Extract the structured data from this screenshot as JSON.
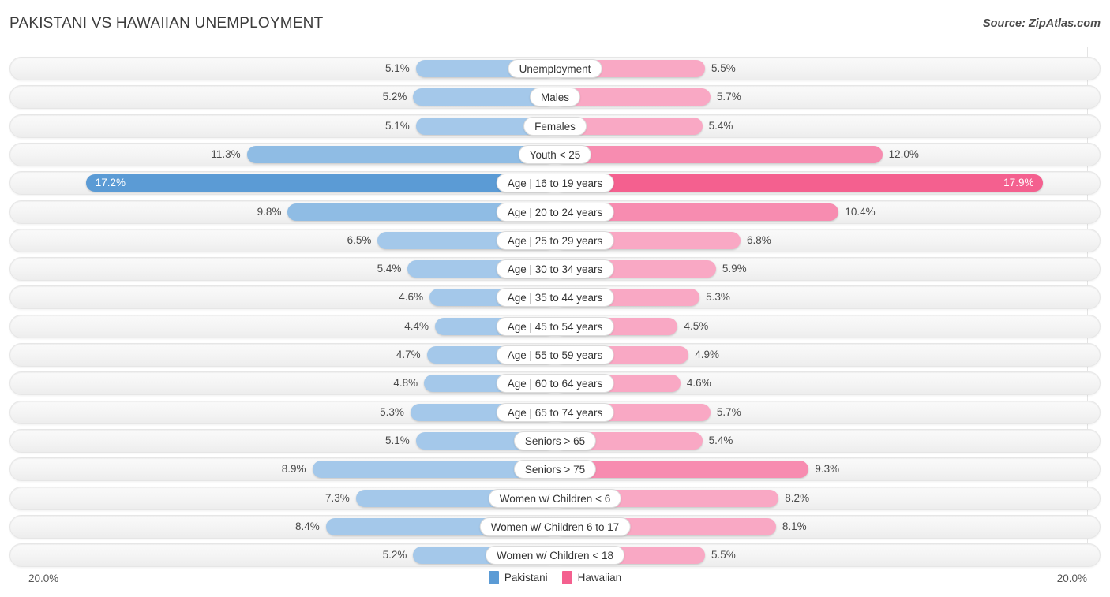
{
  "header": {
    "title": "PAKISTANI VS HAWAIIAN UNEMPLOYMENT",
    "source": "Source: ZipAtlas.com"
  },
  "legend": {
    "items": [
      {
        "label": "Pakistani",
        "color": "#5b9bd5",
        "icon": "square-swatch"
      },
      {
        "label": "Hawaiian",
        "color": "#f4608f",
        "icon": "square-swatch"
      }
    ]
  },
  "axis": {
    "left_label": "20.0%",
    "right_label": "20.0%",
    "max": 20.0
  },
  "colors": {
    "left_light": "#a4c8ea",
    "left_mid": "#8fbce4",
    "left_dark": "#5b9bd5",
    "right_light": "#f9a8c4",
    "right_mid": "#f78cb0",
    "right_dark": "#f4608f",
    "track": "#f4f4f4",
    "text": "#4a4a4a"
  },
  "chart_data": {
    "type": "bar",
    "subtype": "diverging-bar",
    "title": "PAKISTANI VS HAWAIIAN UNEMPLOYMENT",
    "xlabel": "",
    "ylabel": "",
    "xlim": [
      -20.0,
      20.0
    ],
    "grid": true,
    "legend_position": "bottom-center",
    "axis_tick_labels": [
      "20.0%",
      "20.0%"
    ],
    "categories": [
      "Unemployment",
      "Males",
      "Females",
      "Youth < 25",
      "Age | 16 to 19 years",
      "Age | 20 to 24 years",
      "Age | 25 to 29 years",
      "Age | 30 to 34 years",
      "Age | 35 to 44 years",
      "Age | 45 to 54 years",
      "Age | 55 to 59 years",
      "Age | 60 to 64 years",
      "Age | 65 to 74 years",
      "Seniors > 65",
      "Seniors > 75",
      "Women w/ Children < 6",
      "Women w/ Children 6 to 17",
      "Women w/ Children < 18"
    ],
    "series": [
      {
        "name": "Pakistani",
        "color": "#5b9bd5",
        "side": "left",
        "values": [
          5.1,
          5.2,
          5.1,
          11.3,
          17.2,
          9.8,
          6.5,
          5.4,
          4.6,
          4.4,
          4.7,
          4.8,
          5.3,
          5.1,
          8.9,
          7.3,
          8.4,
          5.2
        ],
        "labels": [
          "5.1%",
          "5.2%",
          "5.1%",
          "11.3%",
          "17.2%",
          "9.8%",
          "6.5%",
          "5.4%",
          "4.6%",
          "4.4%",
          "4.7%",
          "4.8%",
          "5.3%",
          "5.1%",
          "8.9%",
          "7.3%",
          "8.4%",
          "5.2%"
        ]
      },
      {
        "name": "Hawaiian",
        "color": "#f4608f",
        "side": "right",
        "values": [
          5.5,
          5.7,
          5.4,
          12.0,
          17.9,
          10.4,
          6.8,
          5.9,
          5.3,
          4.5,
          4.9,
          4.6,
          5.7,
          5.4,
          9.3,
          8.2,
          8.1,
          5.5
        ],
        "labels": [
          "5.5%",
          "5.7%",
          "5.4%",
          "12.0%",
          "17.9%",
          "10.4%",
          "6.8%",
          "5.9%",
          "5.3%",
          "4.5%",
          "4.9%",
          "4.6%",
          "5.7%",
          "5.4%",
          "9.3%",
          "8.2%",
          "8.1%",
          "5.5%"
        ]
      }
    ],
    "rows": [
      {
        "label": "Unemployment",
        "left": 5.1,
        "left_label": "5.1%",
        "right": 5.5,
        "right_label": "5.5%",
        "left_inside": false,
        "right_inside": false
      },
      {
        "label": "Males",
        "left": 5.2,
        "left_label": "5.2%",
        "right": 5.7,
        "right_label": "5.7%",
        "left_inside": false,
        "right_inside": false
      },
      {
        "label": "Females",
        "left": 5.1,
        "left_label": "5.1%",
        "right": 5.4,
        "right_label": "5.4%",
        "left_inside": false,
        "right_inside": false
      },
      {
        "label": "Youth < 25",
        "left": 11.3,
        "left_label": "11.3%",
        "right": 12.0,
        "right_label": "12.0%",
        "left_inside": false,
        "right_inside": false
      },
      {
        "label": "Age | 16 to 19 years",
        "left": 17.2,
        "left_label": "17.2%",
        "right": 17.9,
        "right_label": "17.9%",
        "left_inside": true,
        "right_inside": true
      },
      {
        "label": "Age | 20 to 24 years",
        "left": 9.8,
        "left_label": "9.8%",
        "right": 10.4,
        "right_label": "10.4%",
        "left_inside": false,
        "right_inside": false
      },
      {
        "label": "Age | 25 to 29 years",
        "left": 6.5,
        "left_label": "6.5%",
        "right": 6.8,
        "right_label": "6.8%",
        "left_inside": false,
        "right_inside": false
      },
      {
        "label": "Age | 30 to 34 years",
        "left": 5.4,
        "left_label": "5.4%",
        "right": 5.9,
        "right_label": "5.9%",
        "left_inside": false,
        "right_inside": false
      },
      {
        "label": "Age | 35 to 44 years",
        "left": 4.6,
        "left_label": "4.6%",
        "right": 5.3,
        "right_label": "5.3%",
        "left_inside": false,
        "right_inside": false
      },
      {
        "label": "Age | 45 to 54 years",
        "left": 4.4,
        "left_label": "4.4%",
        "right": 4.5,
        "right_label": "4.5%",
        "left_inside": false,
        "right_inside": false
      },
      {
        "label": "Age | 55 to 59 years",
        "left": 4.7,
        "left_label": "4.7%",
        "right": 4.9,
        "right_label": "4.9%",
        "left_inside": false,
        "right_inside": false
      },
      {
        "label": "Age | 60 to 64 years",
        "left": 4.8,
        "left_label": "4.8%",
        "right": 4.6,
        "right_label": "4.6%",
        "left_inside": false,
        "right_inside": false
      },
      {
        "label": "Age | 65 to 74 years",
        "left": 5.3,
        "left_label": "5.3%",
        "right": 5.7,
        "right_label": "5.7%",
        "left_inside": false,
        "right_inside": false
      },
      {
        "label": "Seniors > 65",
        "left": 5.1,
        "left_label": "5.1%",
        "right": 5.4,
        "right_label": "5.4%",
        "left_inside": false,
        "right_inside": false
      },
      {
        "label": "Seniors > 75",
        "left": 8.9,
        "left_label": "8.9%",
        "right": 9.3,
        "right_label": "9.3%",
        "left_inside": false,
        "right_inside": false
      },
      {
        "label": "Women w/ Children < 6",
        "left": 7.3,
        "left_label": "7.3%",
        "right": 8.2,
        "right_label": "8.2%",
        "left_inside": false,
        "right_inside": false
      },
      {
        "label": "Women w/ Children 6 to 17",
        "left": 8.4,
        "left_label": "8.4%",
        "right": 8.1,
        "right_label": "8.1%",
        "left_inside": false,
        "right_inside": false
      },
      {
        "label": "Women w/ Children < 18",
        "left": 5.2,
        "left_label": "5.2%",
        "right": 5.5,
        "right_label": "5.5%",
        "left_inside": false,
        "right_inside": false
      }
    ]
  }
}
